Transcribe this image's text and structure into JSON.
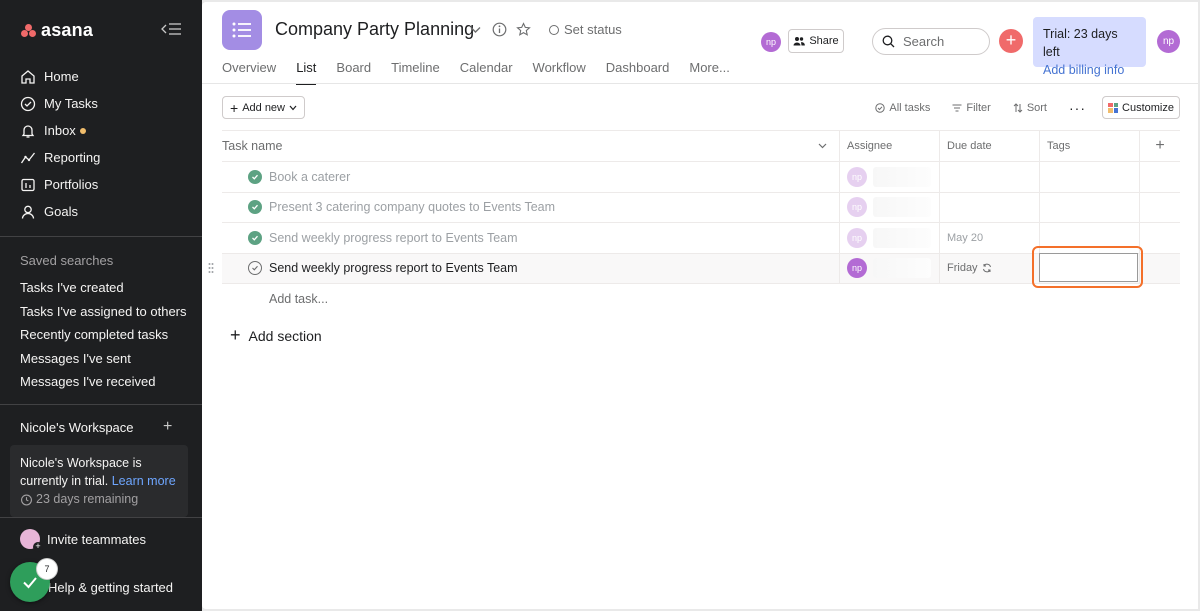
{
  "app": {
    "logo_text": "asana",
    "colors": {
      "sidebar_bg": "#1e1f21",
      "brand_coral": "#f06a6a",
      "project_purple": "#a38de4",
      "check_green": "#5da283",
      "focus_orange": "#f4702a",
      "link_blue": "#4573d2"
    }
  },
  "sidebar": {
    "nav": [
      {
        "label": "Home",
        "icon": "home-icon"
      },
      {
        "label": "My Tasks",
        "icon": "check-circle-icon"
      },
      {
        "label": "Inbox",
        "icon": "bell-icon"
      },
      {
        "label": "Reporting",
        "icon": "trend-line-icon"
      },
      {
        "label": "Portfolios",
        "icon": "portfolio-icon"
      },
      {
        "label": "Goals",
        "icon": "person-goal-icon"
      }
    ],
    "saved_searches_title": "Saved searches",
    "saved_searches": [
      "Tasks I've created",
      "Tasks I've assigned to others",
      "Recently completed tasks",
      "Messages I've sent",
      "Messages I've received"
    ],
    "workspace_title": "Nicole's Workspace",
    "trial_text": "Nicole's Workspace is currently in trial.",
    "learn_more": "Learn more",
    "days_remaining": "23 days remaining",
    "invite": "Invite teammates",
    "help": "Help & getting started",
    "fab_badge": "7"
  },
  "header": {
    "project_title": "Company Party Planning",
    "set_status": "Set status",
    "tabs": [
      "Overview",
      "List",
      "Board",
      "Timeline",
      "Calendar",
      "Workflow",
      "Dashboard",
      "More..."
    ],
    "active_tab": "List",
    "avatar_initials": "np",
    "share": "Share",
    "search_placeholder": "Search",
    "trial_line": "Trial: 23 days left",
    "billing_link": "Add billing info"
  },
  "toolbar": {
    "add_new": "Add new",
    "all_tasks": "All tasks",
    "filter": "Filter",
    "sort": "Sort",
    "customize": "Customize"
  },
  "table": {
    "columns": [
      "Task name",
      "Assignee",
      "Due date",
      "Tags"
    ],
    "rows": [
      {
        "name": "Book a caterer",
        "done": true,
        "assignee": "np",
        "due": ""
      },
      {
        "name": "Present 3 catering company quotes to Events Team",
        "done": true,
        "assignee": "np",
        "due": ""
      },
      {
        "name": "Send weekly progress report to Events Team",
        "done": true,
        "assignee": "np",
        "due": "May 20"
      },
      {
        "name": "Send weekly progress report to Events Team",
        "done": false,
        "assignee": "np",
        "due": "Friday"
      }
    ],
    "add_task": "Add task...",
    "add_section": "Add section"
  }
}
